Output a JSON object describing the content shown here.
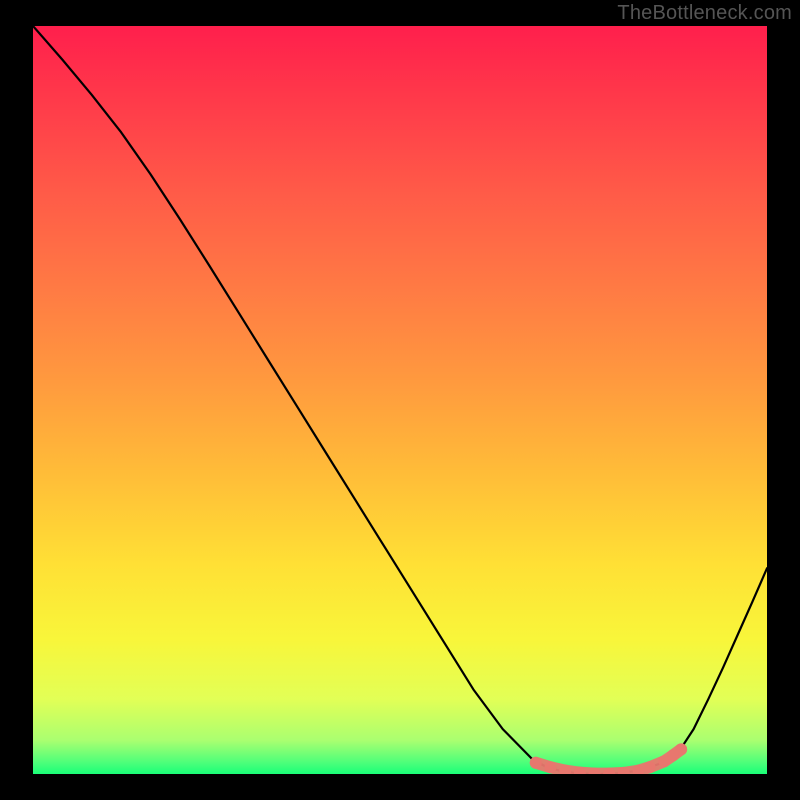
{
  "watermark": "TheBottleneck.com",
  "chart_data": {
    "type": "line",
    "title": "",
    "xlabel": "",
    "ylabel": "",
    "xlim": [
      0,
      100
    ],
    "ylim": [
      0,
      100
    ],
    "series": [
      {
        "name": "bottleneck-curve",
        "x": [
          0,
          4,
          8,
          12,
          16,
          20,
          24,
          28,
          32,
          36,
          40,
          44,
          48,
          52,
          56,
          60,
          64,
          68,
          70,
          72,
          74,
          76,
          78,
          80,
          82,
          84,
          86,
          88,
          90,
          92,
          94,
          96,
          98,
          100
        ],
        "y": [
          100,
          95.5,
          90.8,
          85.8,
          80.2,
          74.2,
          68.0,
          61.7,
          55.4,
          49.1,
          42.8,
          36.5,
          30.2,
          23.9,
          17.6,
          11.3,
          6.0,
          2.0,
          0.9,
          0.4,
          0.1,
          0.0,
          0.0,
          0.1,
          0.4,
          0.9,
          1.6,
          3.0,
          6.0,
          10.0,
          14.2,
          18.6,
          23.0,
          27.5
        ],
        "stroke": "#000000",
        "stroke_width": 2.2
      }
    ],
    "highlight_band": {
      "name": "optimal-zone",
      "x": [
        68.5,
        70.5,
        72.5,
        74.5,
        76.5,
        78.5,
        80.5,
        82.5,
        84.0,
        86.0,
        87.2,
        88.3
      ],
      "y": [
        1.5,
        0.9,
        0.45,
        0.18,
        0.05,
        0.05,
        0.15,
        0.45,
        0.9,
        1.7,
        2.5,
        3.3
      ],
      "color": "#e8776e",
      "marker_radius": 6
    },
    "background_gradient": {
      "stops": [
        {
          "offset": 0.0,
          "color": "#ff1f4c"
        },
        {
          "offset": 0.1,
          "color": "#ff3a4a"
        },
        {
          "offset": 0.22,
          "color": "#ff5a48"
        },
        {
          "offset": 0.35,
          "color": "#ff7a44"
        },
        {
          "offset": 0.48,
          "color": "#ff9b3e"
        },
        {
          "offset": 0.6,
          "color": "#ffbd38"
        },
        {
          "offset": 0.72,
          "color": "#ffe035"
        },
        {
          "offset": 0.82,
          "color": "#f8f63a"
        },
        {
          "offset": 0.9,
          "color": "#e2ff56"
        },
        {
          "offset": 0.955,
          "color": "#aaff70"
        },
        {
          "offset": 0.985,
          "color": "#4cff7a"
        },
        {
          "offset": 1.0,
          "color": "#1aff78"
        }
      ]
    }
  }
}
